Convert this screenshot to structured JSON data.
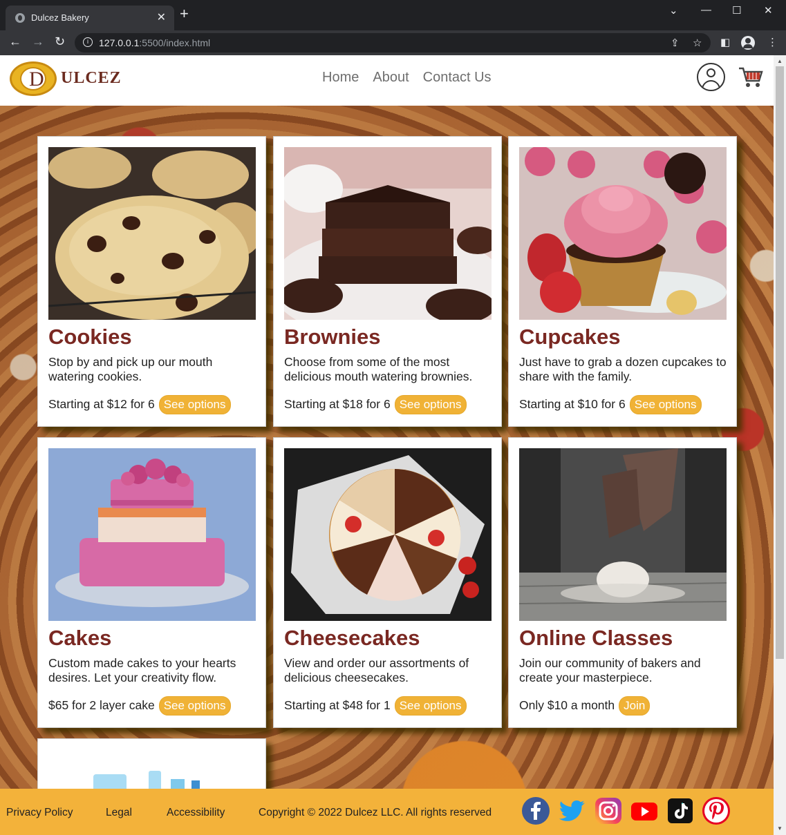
{
  "browser": {
    "tab_title": "Dulcez Bakery",
    "tab_close": "✕",
    "new_tab": "+",
    "url_main": "127.0.0.1",
    "url_dim": ":5500/index.html",
    "win_min": "—",
    "win_max": "☐",
    "win_close": "✕",
    "back": "←",
    "forward": "→",
    "reload": "↻",
    "menu": "⋮"
  },
  "header": {
    "logo_letter": "D",
    "logo_word": "ULCEZ",
    "nav": [
      "Home",
      "About",
      "Contact Us"
    ]
  },
  "cards": [
    {
      "title": "Cookies",
      "desc": "Stop by and pick up our mouth watering cookies.",
      "price": "Starting at $12 for 6",
      "button": "See options"
    },
    {
      "title": "Brownies",
      "desc": "Choose from some of the most delicious mouth watering brownies.",
      "price": "Starting at $18 for 6",
      "button": "See options"
    },
    {
      "title": "Cupcakes",
      "desc": "Just have to grab a dozen cupcakes to share with the family.",
      "price": "Starting at $10 for 6",
      "button": "See options"
    },
    {
      "title": "Cakes",
      "desc": "Custom made cakes to your hearts desires. Let your creativity flow.",
      "price": "$65 for 2 layer cake",
      "button": "See options"
    },
    {
      "title": "Cheesecakes",
      "desc": "View and order our assortments of delicious cheesecakes.",
      "price": "Starting at $48 for 1",
      "button": "See options"
    },
    {
      "title": "Online Classes",
      "desc": "Join our community of bakers and create your masterpiece.",
      "price": "Only $10 a month",
      "button": "Join"
    }
  ],
  "footer": {
    "links": [
      "Privacy Policy",
      "Legal",
      "Accessibility"
    ],
    "copyright": "Copyright © 2022 Dulcez LLC. All rights reserved",
    "social": [
      "facebook-icon",
      "twitter-icon",
      "instagram-icon",
      "youtube-icon",
      "tiktok-icon",
      "pinterest-icon"
    ]
  },
  "colors": {
    "accent": "#f3b23a",
    "title": "#7a2822",
    "button": "#f0b236"
  }
}
